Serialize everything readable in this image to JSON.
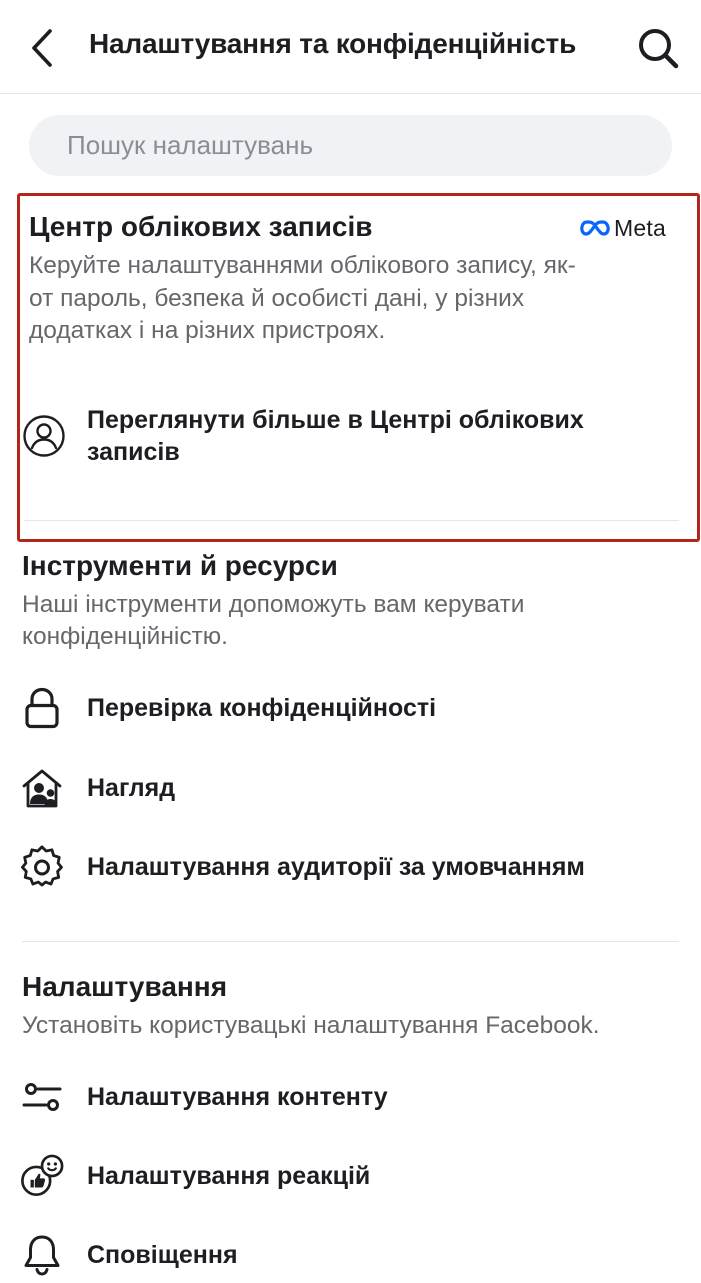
{
  "header": {
    "title": "Налаштування та конфіденційність"
  },
  "search": {
    "placeholder": "Пошук налаштувань"
  },
  "accounts_center": {
    "title": "Центр облікових записів",
    "brand": "Meta",
    "description": "Керуйте налаштуваннями облікового запису, як-от пароль, безпека й особисті дані, у різних додатках і на різних пристроях.",
    "link_label": "Переглянути більше в Центрі облікових записів",
    "highlight_color": "#b2261b"
  },
  "tools_section": {
    "title": "Інструменти й ресурси",
    "description": "Наші інструменти допоможуть вам керувати конфіденційністю.",
    "items": [
      {
        "label": "Перевірка конфіденційності",
        "icon": "lock-icon"
      },
      {
        "label": "Нагляд",
        "icon": "supervision-home-icon"
      },
      {
        "label": "Налаштування аудиторії за умовчанням",
        "icon": "gear-icon"
      }
    ]
  },
  "settings_section": {
    "title": "Налаштування",
    "description": "Установіть користувацькі налаштування Facebook.",
    "items": [
      {
        "label": "Налаштування контенту",
        "icon": "sliders-icon"
      },
      {
        "label": "Налаштування реакцій",
        "icon": "reactions-icon"
      },
      {
        "label": "Сповіщення",
        "icon": "bell-icon"
      }
    ]
  },
  "colors": {
    "text_primary": "#1c1e21",
    "text_secondary": "#65676b",
    "search_bg": "#f0f2f5",
    "meta_blue": "#0866ff"
  }
}
